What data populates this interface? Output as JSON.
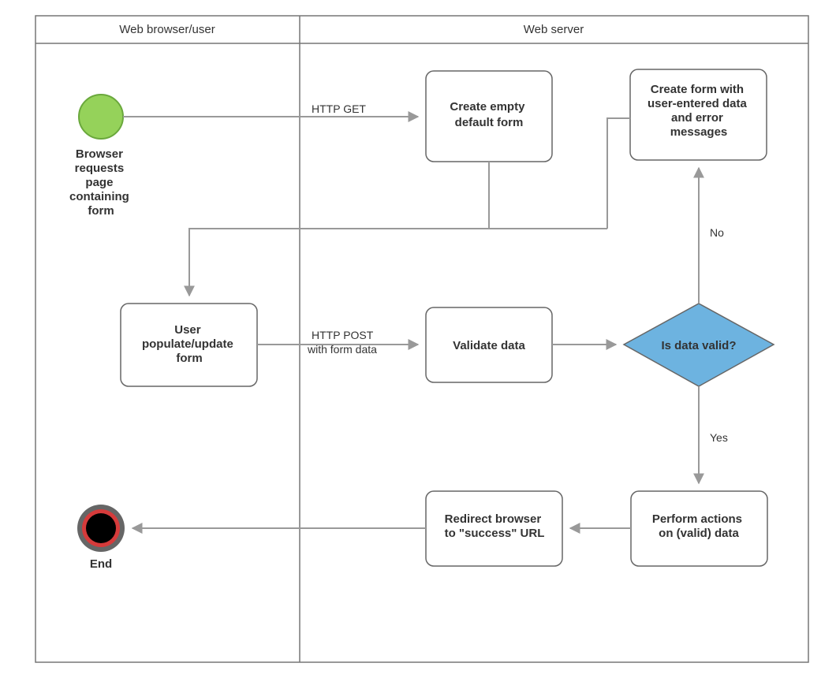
{
  "lanes": {
    "left": "Web browser/user",
    "right": "Web server"
  },
  "nodes": {
    "start_label": "Browser requests page containing form",
    "create_empty": "Create empty default form",
    "create_error": "Create form with user-entered data and error messages",
    "user_populate": "User populate/update form",
    "validate": "Validate data",
    "decision": "Is data valid?",
    "perform": "Perform actions on (valid) data",
    "redirect": "Redirect browser to \"success\" URL",
    "end_label": "End"
  },
  "edges": {
    "http_get": "HTTP GET",
    "http_post_l1": "HTTP POST",
    "http_post_l2": "with form data",
    "no": "No",
    "yes": "Yes"
  }
}
